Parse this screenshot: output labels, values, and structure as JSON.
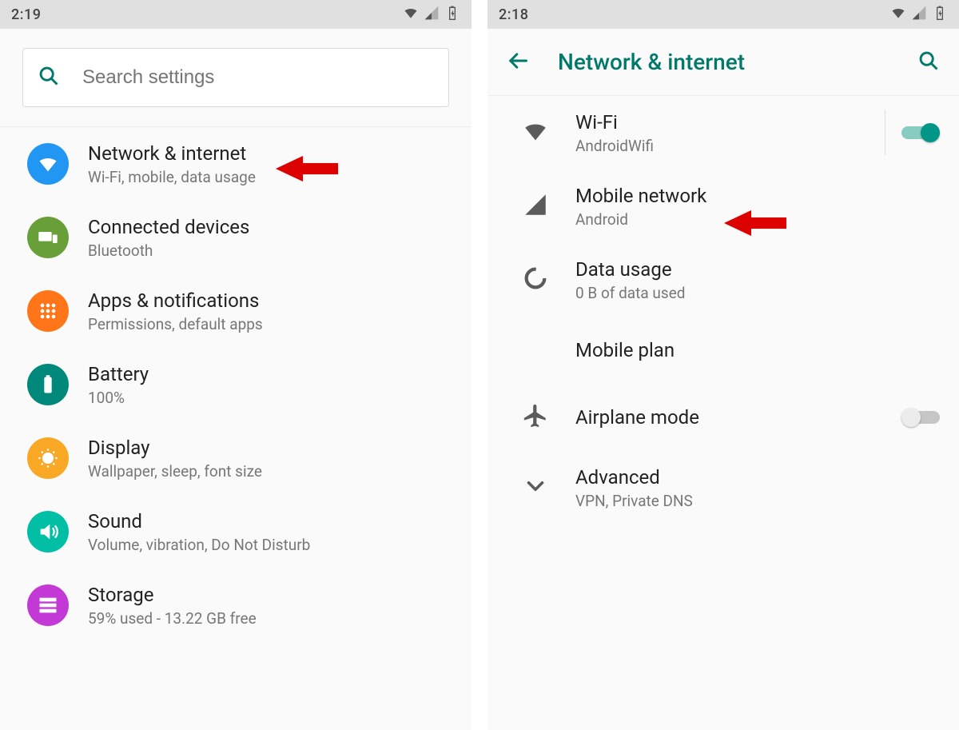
{
  "left": {
    "status_time": "2:19",
    "search_placeholder": "Search settings",
    "items": [
      {
        "title": "Network & internet",
        "sub": "Wi-Fi, mobile, data usage",
        "icon": "wifi",
        "color": "#2196f3"
      },
      {
        "title": "Connected devices",
        "sub": "Bluetooth",
        "icon": "devices",
        "color": "#689f38"
      },
      {
        "title": "Apps & notifications",
        "sub": "Permissions, default apps",
        "icon": "apps",
        "color": "#ff7518"
      },
      {
        "title": "Battery",
        "sub": "100%",
        "icon": "battery",
        "color": "#00897b"
      },
      {
        "title": "Display",
        "sub": "Wallpaper, sleep, font size",
        "icon": "display",
        "color": "#f9a825"
      },
      {
        "title": "Sound",
        "sub": "Volume, vibration, Do Not Disturb",
        "icon": "sound",
        "color": "#00bfa5"
      },
      {
        "title": "Storage",
        "sub": "59% used - 13.22 GB free",
        "icon": "storage",
        "color": "#c239d6"
      }
    ]
  },
  "right": {
    "status_time": "2:18",
    "header_title": "Network & internet",
    "items": [
      {
        "title": "Wi-Fi",
        "sub": "AndroidWifi",
        "icon": "wifi-gray",
        "toggle": "on",
        "divider": true
      },
      {
        "title": "Mobile network",
        "sub": "Android",
        "icon": "signal",
        "toggle": null
      },
      {
        "title": "Data usage",
        "sub": "0 B of data used",
        "icon": "data",
        "toggle": null
      },
      {
        "title": "Mobile plan",
        "sub": "",
        "icon": "",
        "toggle": null
      },
      {
        "title": "Airplane mode",
        "sub": "",
        "icon": "airplane",
        "toggle": "off"
      },
      {
        "title": "Advanced",
        "sub": "VPN, Private DNS",
        "icon": "expand",
        "toggle": null
      }
    ]
  },
  "colors": {
    "accent": "#00796b"
  }
}
